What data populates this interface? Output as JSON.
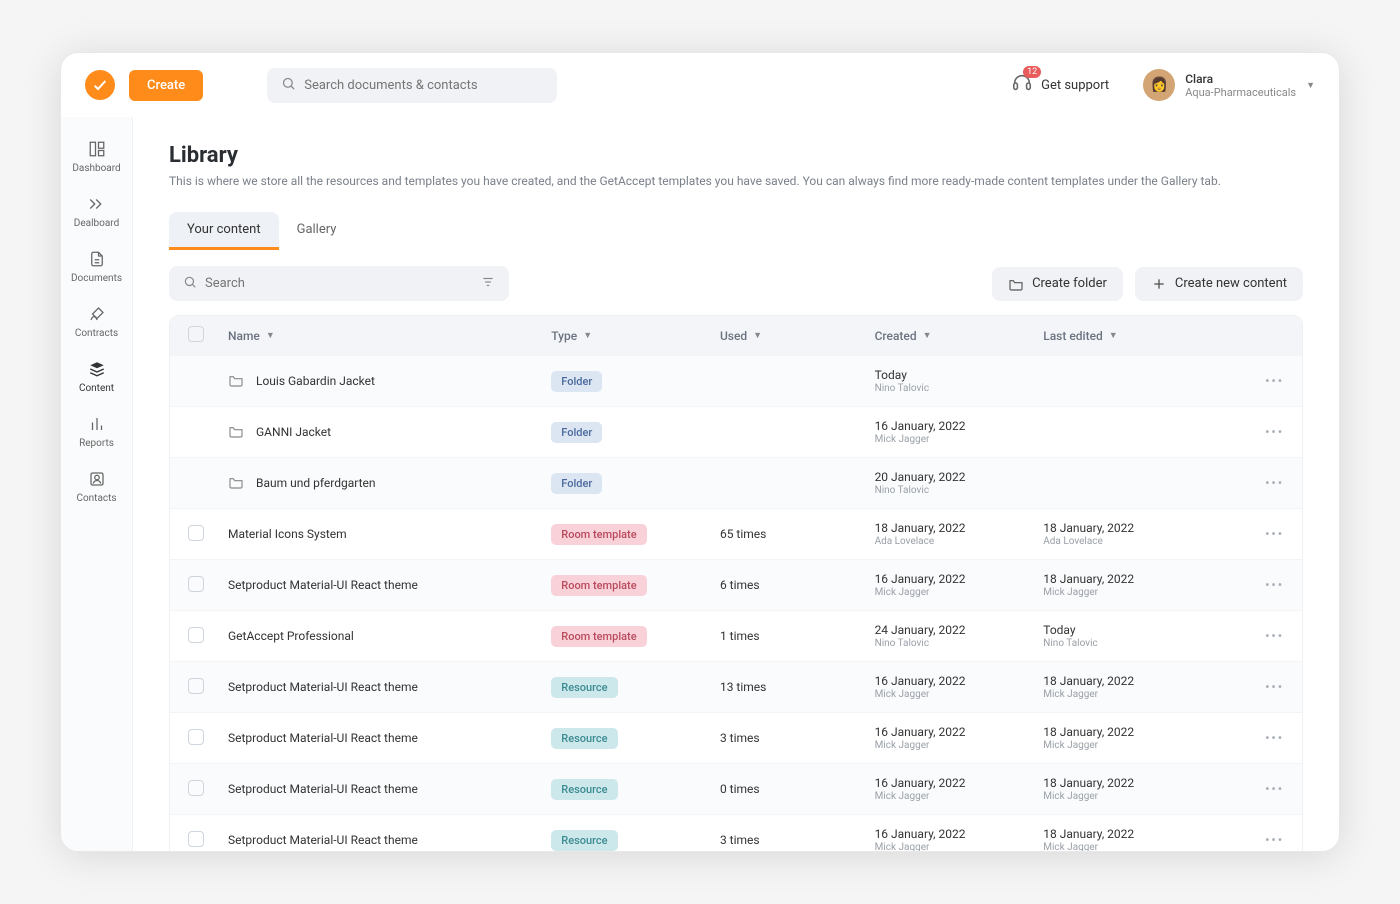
{
  "header": {
    "create_label": "Create",
    "search_placeholder": "Search documents & contacts",
    "support_label": "Get support",
    "support_badge": "12",
    "user_name": "Clara",
    "user_company": "Aqua-Pharmaceuticals"
  },
  "sidebar": {
    "items": [
      {
        "label": "Dashboard",
        "active": false
      },
      {
        "label": "Dealboard",
        "active": false
      },
      {
        "label": "Documents",
        "active": false
      },
      {
        "label": "Contracts",
        "active": false
      },
      {
        "label": "Content",
        "active": true
      },
      {
        "label": "Reports",
        "active": false
      },
      {
        "label": "Contacts",
        "active": false
      }
    ]
  },
  "page": {
    "title": "Library",
    "description": "This is where we store all the resources and templates you have created, and the GetAccept templates you have saved. You can always find more ready-made content templates under the Gallery tab."
  },
  "tabs": [
    {
      "label": "Your content",
      "active": true
    },
    {
      "label": "Gallery",
      "active": false
    }
  ],
  "toolbar": {
    "search_placeholder": "Search",
    "create_folder_label": "Create folder",
    "create_content_label": "Create new content"
  },
  "columns": {
    "name": "Name",
    "type": "Type",
    "used": "Used",
    "created": "Created",
    "last_edited": "Last edited"
  },
  "rows": [
    {
      "checkbox": false,
      "icon": "folder",
      "name": "Louis Gabardin Jacket",
      "type": "Folder",
      "type_class": "pill-folder",
      "used": "",
      "created_date": "Today",
      "created_by": "Nino Talovic",
      "edited_date": "",
      "edited_by": ""
    },
    {
      "checkbox": false,
      "icon": "folder",
      "name": "GANNI Jacket",
      "type": "Folder",
      "type_class": "pill-folder",
      "used": "",
      "created_date": "16 January, 2022",
      "created_by": "Mick Jagger",
      "edited_date": "",
      "edited_by": ""
    },
    {
      "checkbox": false,
      "icon": "folder",
      "name": "Baum und pferdgarten",
      "type": "Folder",
      "type_class": "pill-folder",
      "used": "",
      "created_date": "20 January, 2022",
      "created_by": "Nino Talovic",
      "edited_date": "",
      "edited_by": ""
    },
    {
      "checkbox": true,
      "icon": "",
      "name": "Material Icons System",
      "type": "Room template",
      "type_class": "pill-room",
      "used": "65 times",
      "created_date": "18 January, 2022",
      "created_by": "Ada Lovelace",
      "edited_date": "18 January, 2022",
      "edited_by": "Ada Lovelace"
    },
    {
      "checkbox": true,
      "icon": "",
      "name": "Setproduct Material-UI React theme",
      "type": "Room template",
      "type_class": "pill-room",
      "used": "6 times",
      "created_date": "16 January, 2022",
      "created_by": "Mick Jagger",
      "edited_date": "18 January, 2022",
      "edited_by": "Mick Jagger"
    },
    {
      "checkbox": true,
      "icon": "",
      "name": "GetAccept Professional",
      "type": "Room template",
      "type_class": "pill-room",
      "used": "1 times",
      "created_date": "24 January, 2022",
      "created_by": "Nino Talovic",
      "edited_date": "Today",
      "edited_by": "Nino Talovic"
    },
    {
      "checkbox": true,
      "icon": "",
      "name": "Setproduct Material-UI React theme",
      "type": "Resource",
      "type_class": "pill-resource",
      "used": "13 times",
      "created_date": "16 January, 2022",
      "created_by": "Mick Jagger",
      "edited_date": "18 January, 2022",
      "edited_by": "Mick Jagger"
    },
    {
      "checkbox": true,
      "icon": "",
      "name": "Setproduct Material-UI React theme",
      "type": "Resource",
      "type_class": "pill-resource",
      "used": "3 times",
      "created_date": "16 January, 2022",
      "created_by": "Mick Jagger",
      "edited_date": "18 January, 2022",
      "edited_by": "Mick Jagger"
    },
    {
      "checkbox": true,
      "icon": "",
      "name": "Setproduct Material-UI React theme",
      "type": "Resource",
      "type_class": "pill-resource",
      "used": "0 times",
      "created_date": "16 January, 2022",
      "created_by": "Mick Jagger",
      "edited_date": "18 January, 2022",
      "edited_by": "Mick Jagger"
    },
    {
      "checkbox": true,
      "icon": "",
      "name": "Setproduct Material-UI React theme",
      "type": "Resource",
      "type_class": "pill-resource",
      "used": "3 times",
      "created_date": "16 January, 2022",
      "created_by": "Mick Jagger",
      "edited_date": "18 January, 2022",
      "edited_by": "Mick Jagger"
    }
  ]
}
